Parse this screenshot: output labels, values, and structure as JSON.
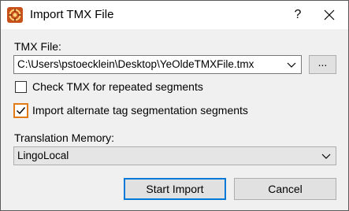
{
  "window": {
    "title": "Import TMX File",
    "help_label": "?",
    "close_label": "✕"
  },
  "tmx_file": {
    "label": "TMX File:",
    "value": "C:\\Users\\pstoecklein\\Desktop\\YeOldeTMXFile.tmx",
    "browse_label": "..."
  },
  "options": {
    "check_repeated": {
      "label": "Check TMX for repeated segments",
      "checked": false
    },
    "import_alternate": {
      "label": "Import alternate tag segmentation segments",
      "checked": true
    }
  },
  "translation_memory": {
    "label": "Translation Memory:",
    "value": "LingoLocal"
  },
  "buttons": {
    "start_import": "Start Import",
    "cancel": "Cancel"
  },
  "colors": {
    "accent": "#0078d7",
    "focus": "#e07b17",
    "app_icon": "#c8501a"
  }
}
